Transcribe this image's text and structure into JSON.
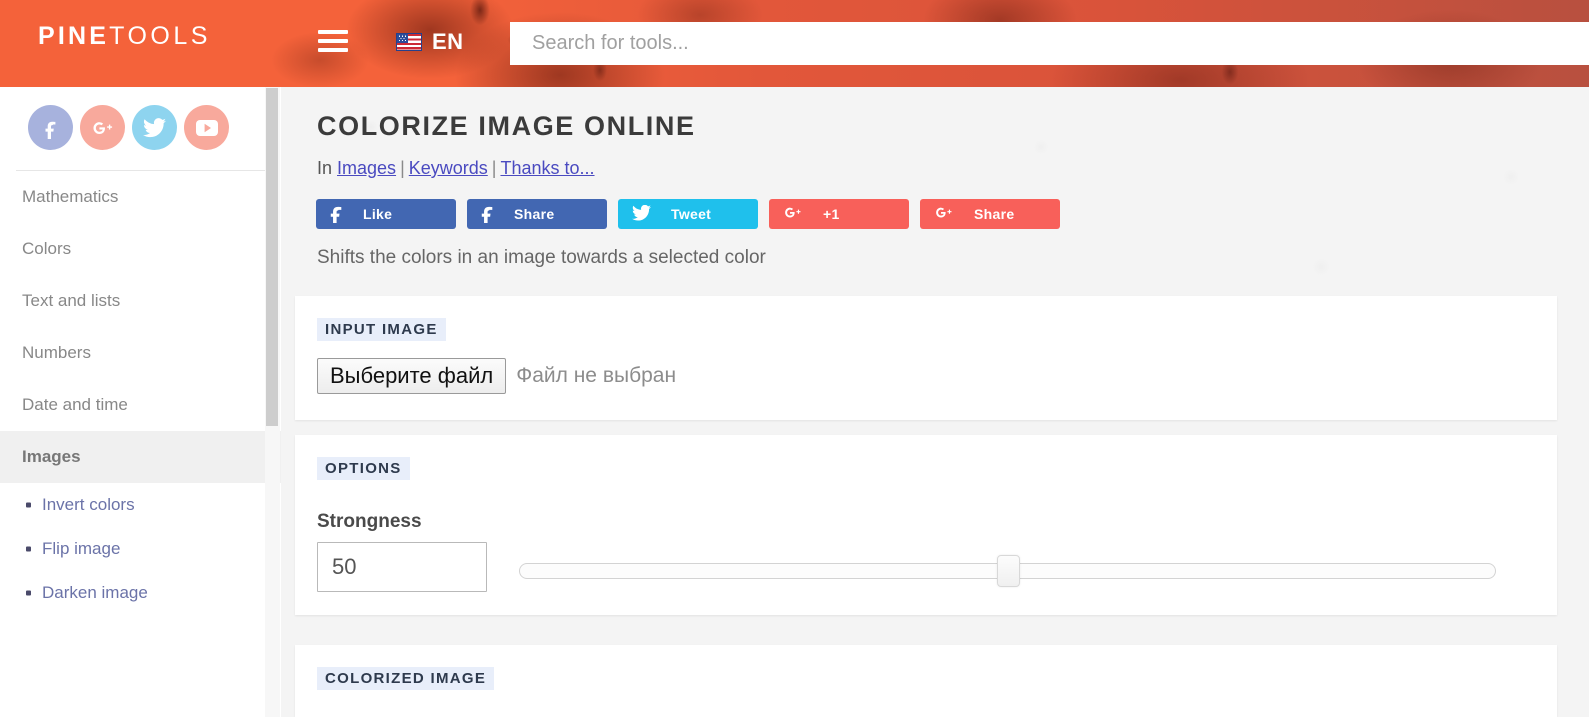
{
  "header": {
    "logo_bold": "PINE",
    "logo_thin": "TOOLS",
    "menu_icon": "hamburger-icon",
    "flag_icon": "us-flag-icon",
    "language": "EN",
    "search_placeholder": "Search for tools...",
    "search_value": "",
    "accent_color": "#f4623a"
  },
  "sidebar": {
    "social": [
      {
        "name": "facebook",
        "label": "Facebook",
        "color": "#a7b2dd"
      },
      {
        "name": "google-plus",
        "label": "Google Plus",
        "color": "#f8a99c"
      },
      {
        "name": "twitter",
        "label": "Twitter",
        "color": "#8ed4ef"
      },
      {
        "name": "youtube",
        "label": "YouTube",
        "color": "#f8a99c"
      }
    ],
    "categories": [
      {
        "label": "Mathematics",
        "active": false
      },
      {
        "label": "Colors",
        "active": false
      },
      {
        "label": "Text and lists",
        "active": false
      },
      {
        "label": "Numbers",
        "active": false
      },
      {
        "label": "Date and time",
        "active": false
      },
      {
        "label": "Images",
        "active": true
      }
    ],
    "subitems": [
      {
        "label": "Invert colors"
      },
      {
        "label": "Flip image"
      },
      {
        "label": "Darken image"
      }
    ]
  },
  "main": {
    "title": "COLORIZE IMAGE ONLINE",
    "breadcrumb": {
      "prefix": "In",
      "link1": "Images",
      "link2": "Keywords",
      "link3": "Thanks to...",
      "separator": "|"
    },
    "share_buttons": [
      {
        "icon": "facebook-icon",
        "label": "Like",
        "color": "#4267b2"
      },
      {
        "icon": "facebook-icon",
        "label": "Share",
        "color": "#4267b2"
      },
      {
        "icon": "twitter-icon",
        "label": "Tweet",
        "color": "#1fc0ec"
      },
      {
        "icon": "google-plus-icon",
        "label": "+1",
        "color": "#f8605a"
      },
      {
        "icon": "google-plus-icon",
        "label": "Share",
        "color": "#f8605a"
      }
    ],
    "description": "Shifts the colors in an image towards a selected color",
    "input_panel": {
      "label": "INPUT IMAGE",
      "file_button": "Выберите файл",
      "file_status": "Файл не выбран"
    },
    "options_panel": {
      "label": "OPTIONS",
      "option_name": "Strongness",
      "value": "50",
      "slider_min": 0,
      "slider_max": 100,
      "slider_value": 50
    },
    "output_panel": {
      "label": "COLORIZED IMAGE"
    }
  }
}
